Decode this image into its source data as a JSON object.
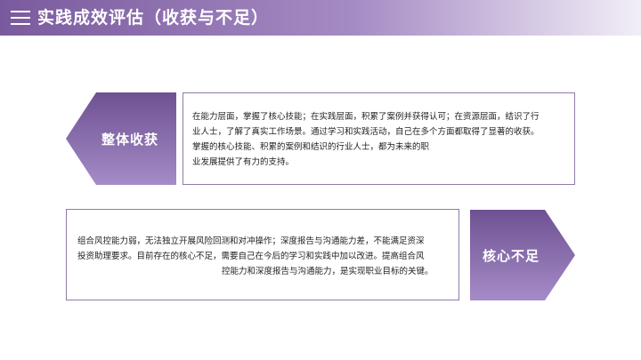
{
  "header": {
    "title": "实践成效评估（收获与不足）"
  },
  "gains": {
    "label": "整体收获",
    "lines": [
      "在能力层面，掌握了核心技能；在实践层面，积累了案例并获得认可；在资源层面，结识了行",
      "业人士，了解了真实工作场景。通过学习和实践活动，自己在多个方面都取得了显著的收获。",
      "掌握的核心技能、积累的案例和结识的行业人士，都为未来的职",
      "业发展提供了有力的支持。"
    ]
  },
  "shortcomings": {
    "label": "核心不足",
    "lines": [
      "组合风控能力弱，无法独立开展风险回测和对冲操作；深度报告与沟通能力差，不能满足资深",
      "投资助理要求。目前存在的核心不足，需要自己在今后的学习和实践中加以改进。提高组合风",
      "控能力和深度报告与沟通能力，是实现职业目标的关键。"
    ]
  }
}
